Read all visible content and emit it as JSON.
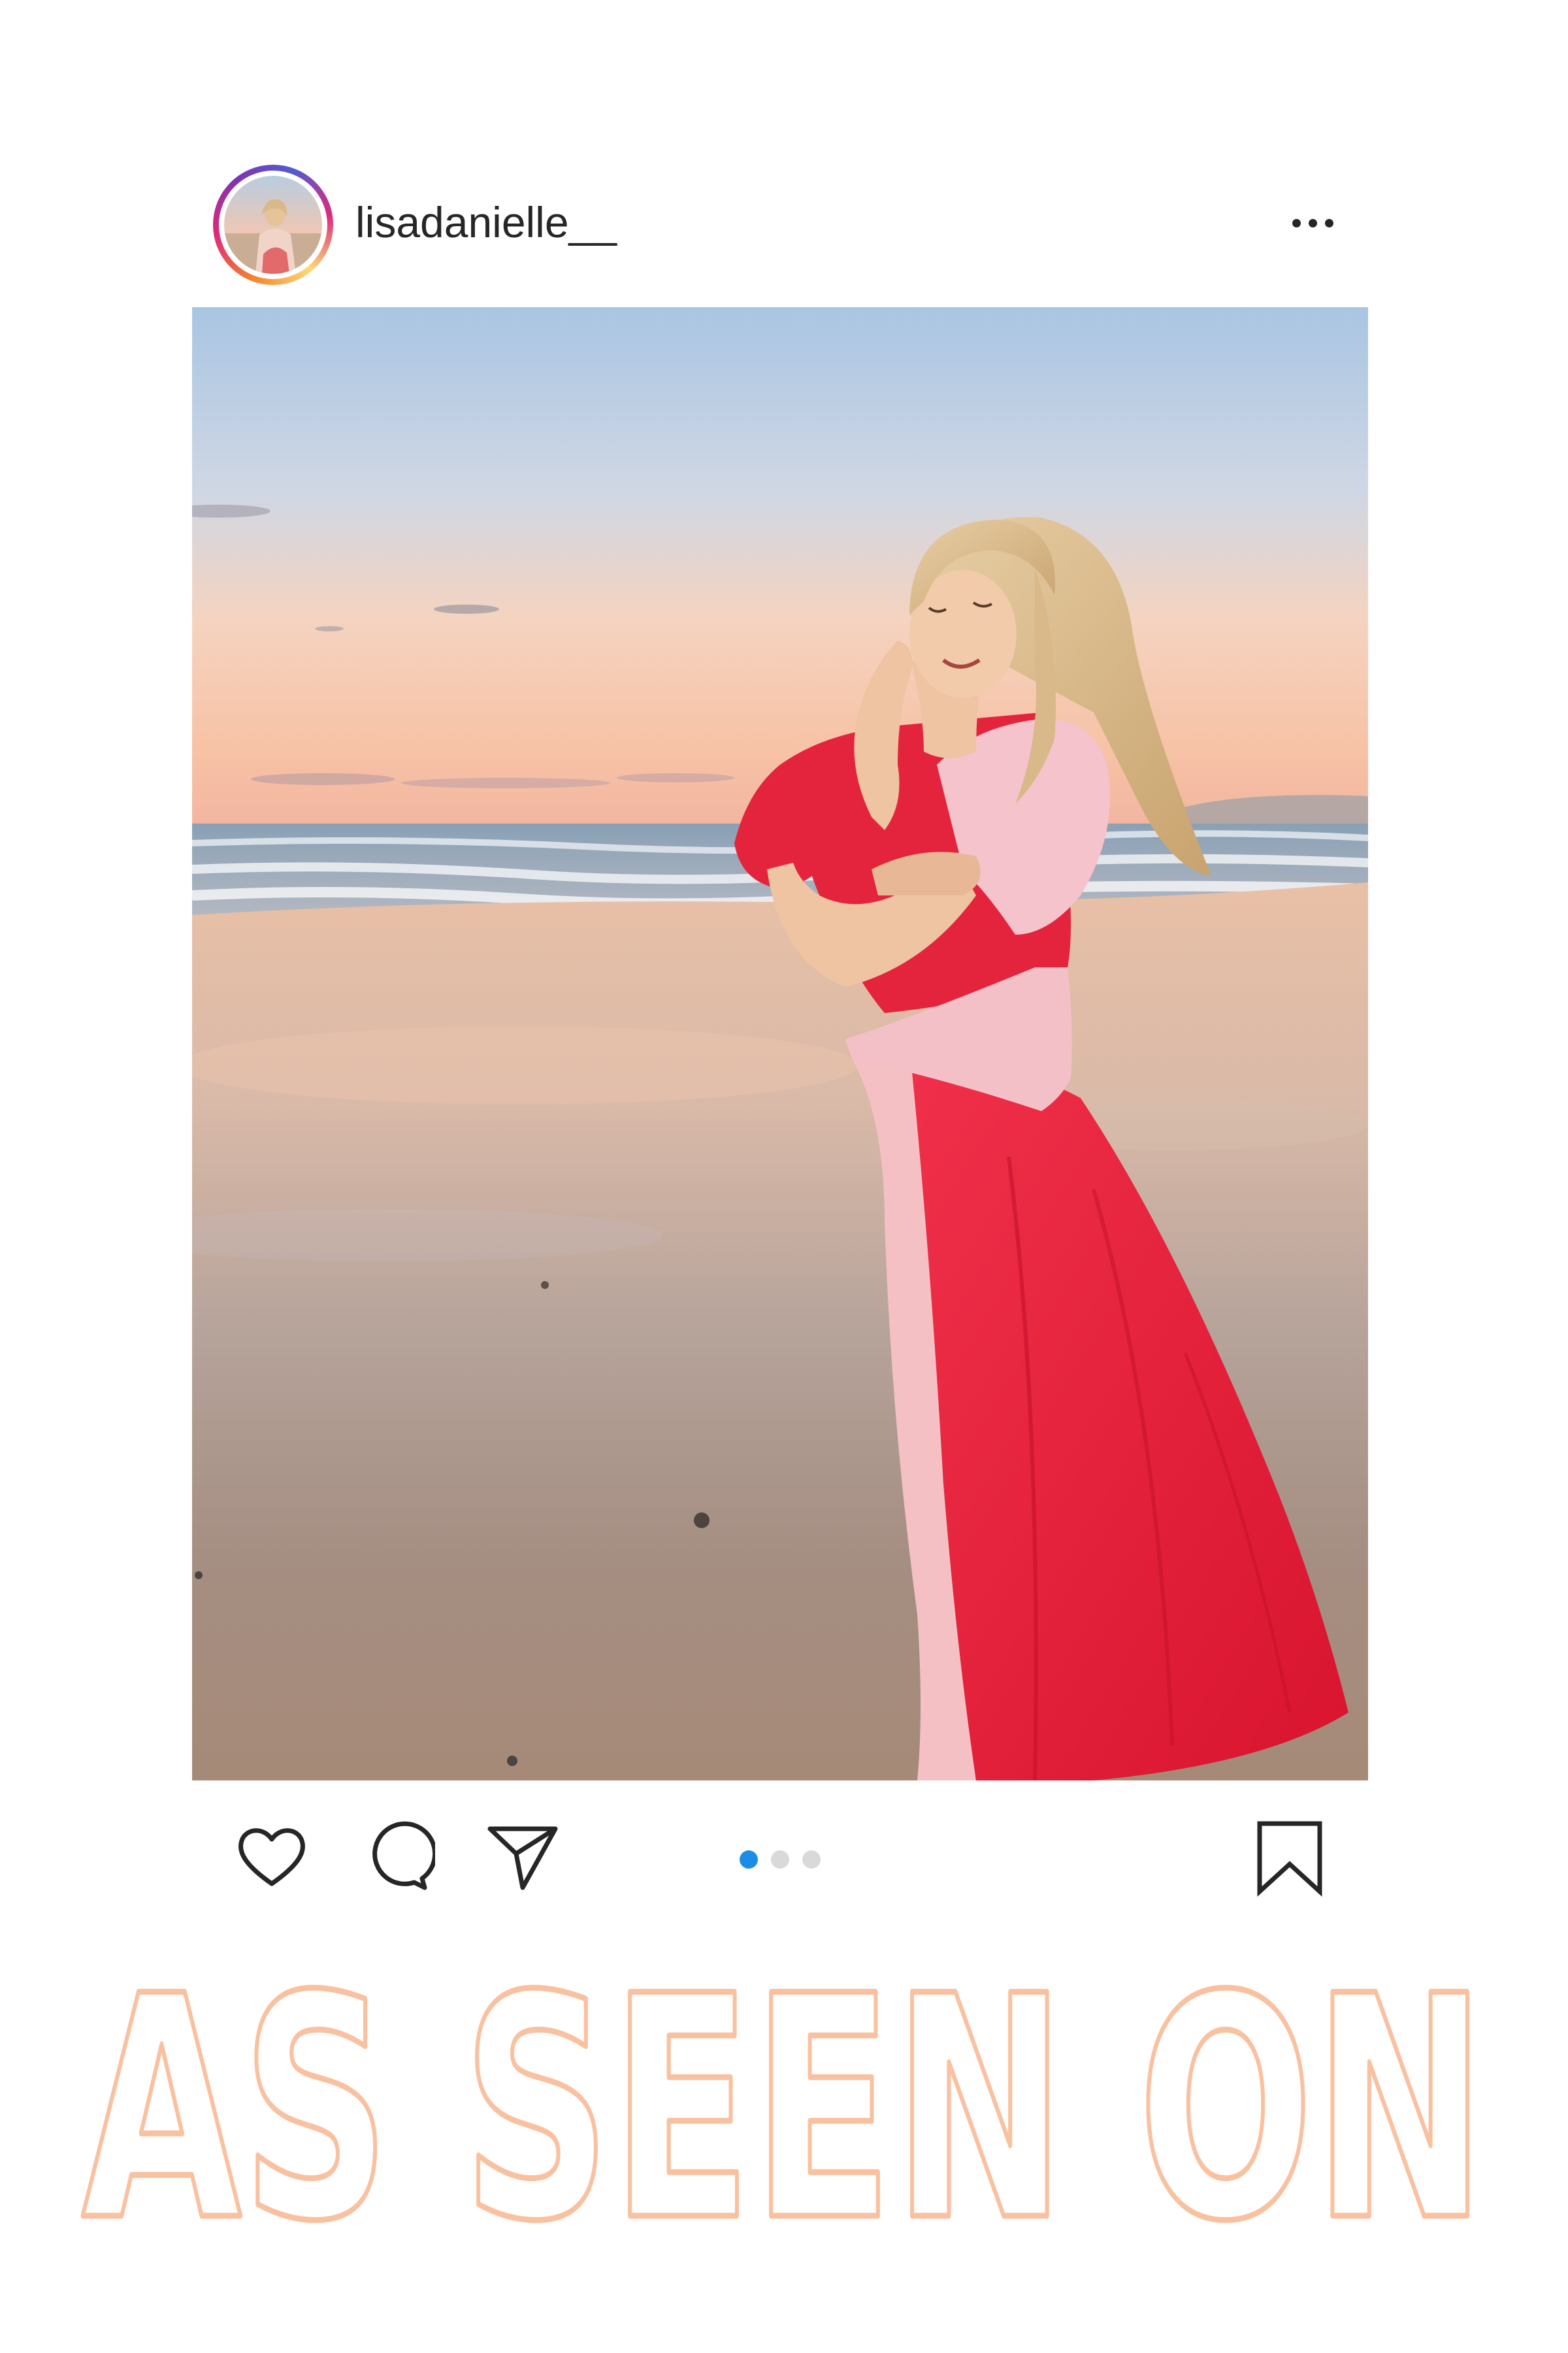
{
  "post": {
    "username": "lisadanielle__",
    "more_label": "More options",
    "carousel": {
      "count": 3,
      "active_index": 0
    }
  },
  "banner": {
    "text": "AS SEEN ON"
  },
  "colors": {
    "text": "#262626",
    "carousel_active": "#1c8de6",
    "carousel_inactive": "#d9d9d9",
    "banner_outline": "#f9c1a0"
  },
  "icons": {
    "like": "heart-icon",
    "comment": "speech-bubble-icon",
    "share": "paper-plane-icon",
    "save": "bookmark-icon",
    "more": "ellipsis-icon"
  }
}
